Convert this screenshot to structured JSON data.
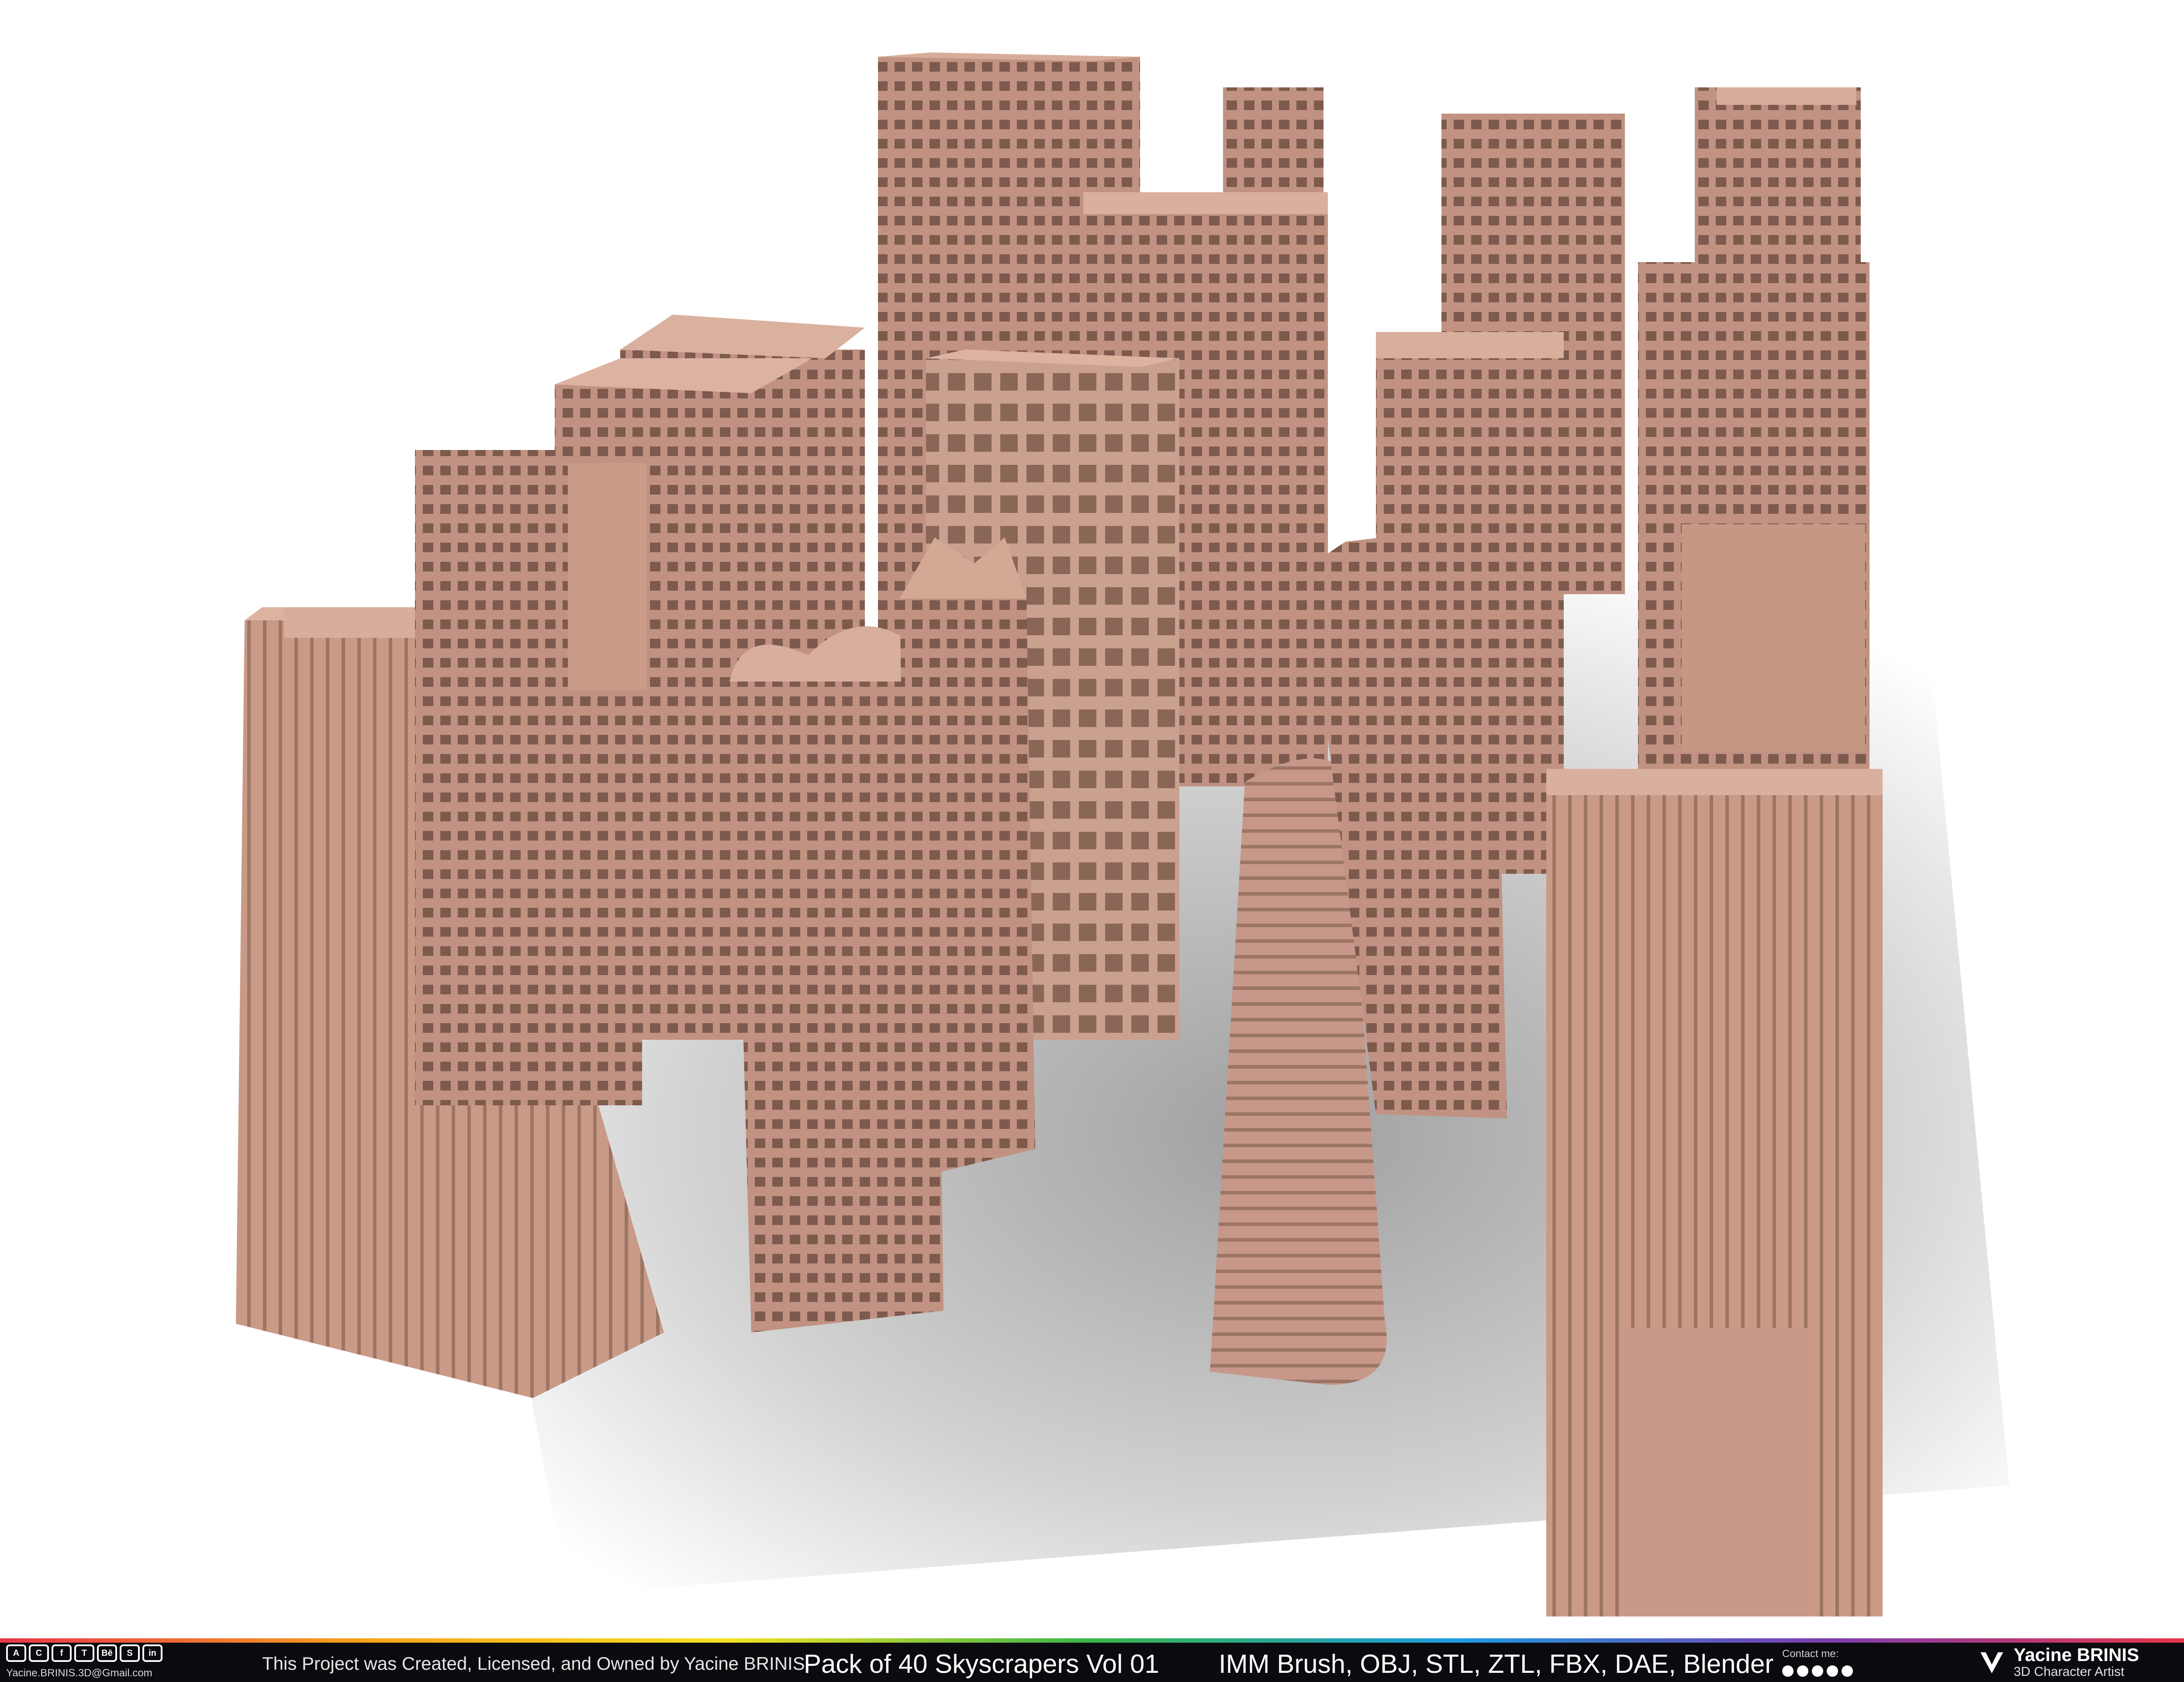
{
  "scene": {
    "description_icon": "skyscraper-render",
    "colors": {
      "building": "#c79a87",
      "shadow": "#9c9c9c",
      "background": "#ffffff"
    }
  },
  "footer": {
    "email": "Yacine.BRINIS.3D@Gmail.com",
    "ownership": "This Project was Created, Licensed, and Owned by Yacine BRINIS",
    "title": "Pack of 40 Skyscrapers Vol 01",
    "formats": "IMM Brush, OBJ, STL, ZTL, FBX, DAE, Blender",
    "contact_label": "Contact me:",
    "author_name": "Yacine BRINIS",
    "author_role": "3D Character Artist",
    "icons": [
      "artstation-icon",
      "cgtrader-icon",
      "facebook-icon",
      "turbosquid-icon",
      "behance-icon",
      "sketchfab-icon",
      "linkedin-icon"
    ]
  }
}
